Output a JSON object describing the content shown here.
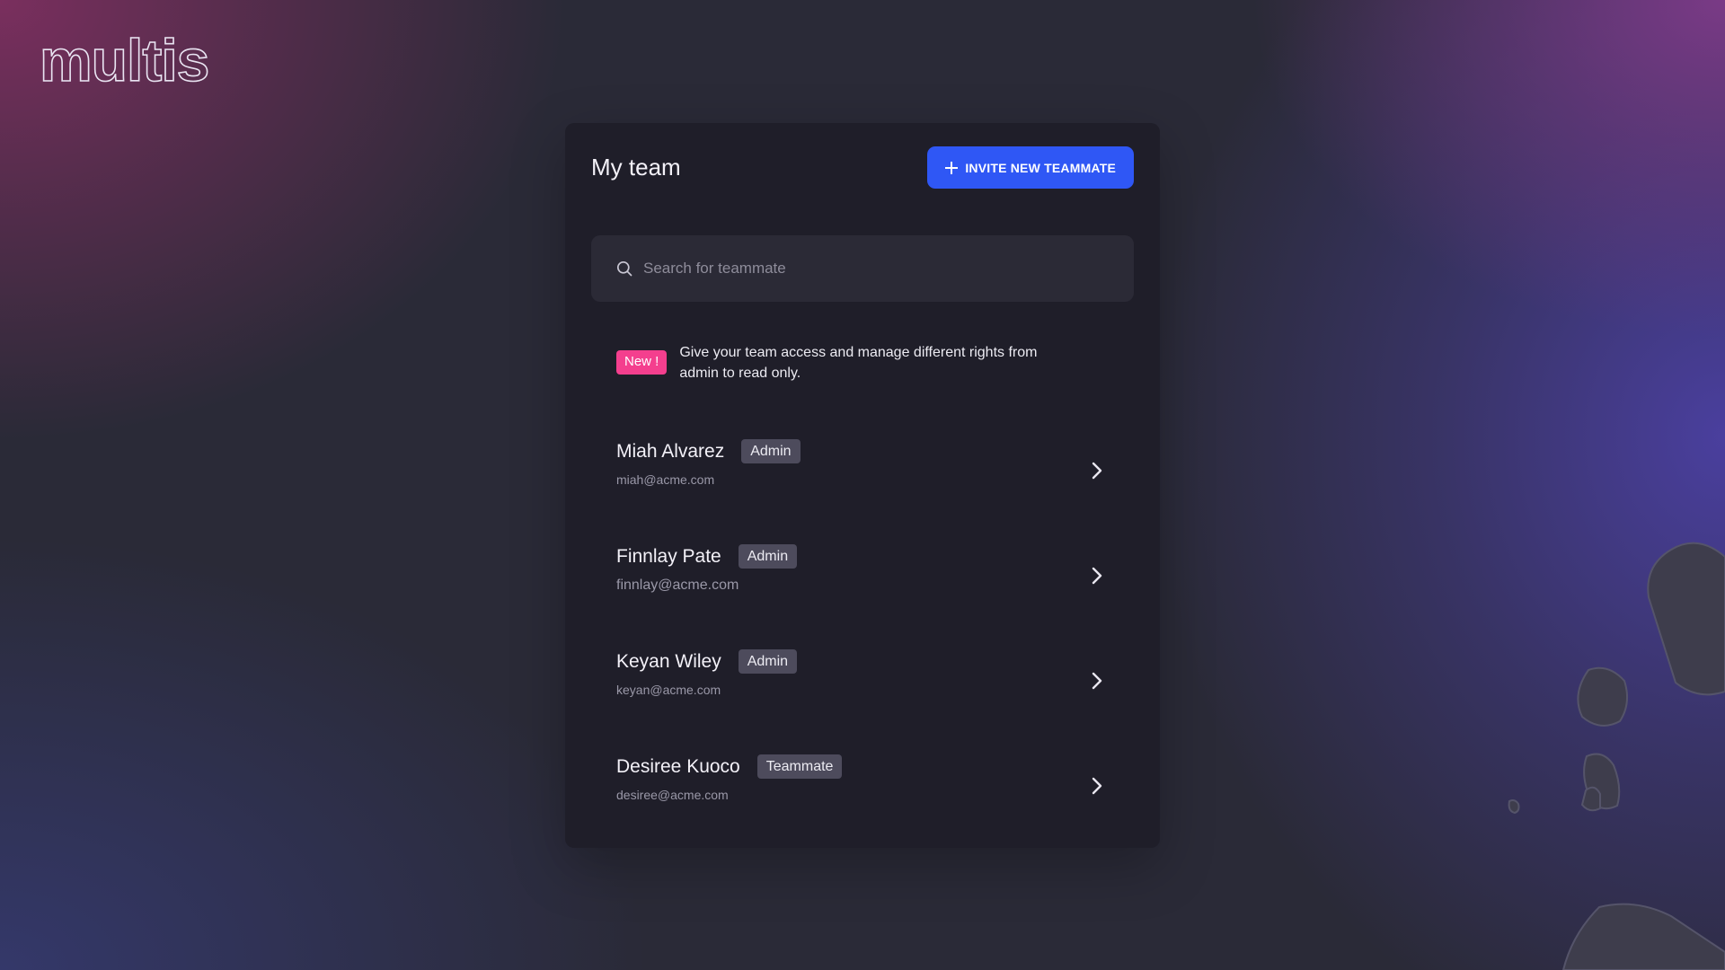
{
  "brand": {
    "logo_text": "multis"
  },
  "panel": {
    "title": "My team",
    "invite_button": "INVITE NEW TEAMMATE"
  },
  "search": {
    "placeholder": "Search for teammate",
    "value": ""
  },
  "notice": {
    "badge": "New !",
    "text": "Give your team access and manage different rights from admin to read only."
  },
  "members": [
    {
      "name": "Miah Alvarez",
      "role": "Admin",
      "email": "miah@acme.com"
    },
    {
      "name": "Finnlay Pate",
      "role": "Admin",
      "email": "finnlay@acme.com"
    },
    {
      "name": "Keyan Wiley",
      "role": "Admin",
      "email": "keyan@acme.com"
    },
    {
      "name": "Desiree Kuoco",
      "role": "Teammate",
      "email": "desiree@acme.com"
    }
  ],
  "colors": {
    "accent": "#2f57f5",
    "new_badge": "#f43f8e",
    "panel_bg": "#1f1e29",
    "role_badge": "#4d4b5c"
  },
  "icons": {
    "invite": "plus-icon",
    "search": "search-icon",
    "member_action": "chevron-right-icon"
  }
}
